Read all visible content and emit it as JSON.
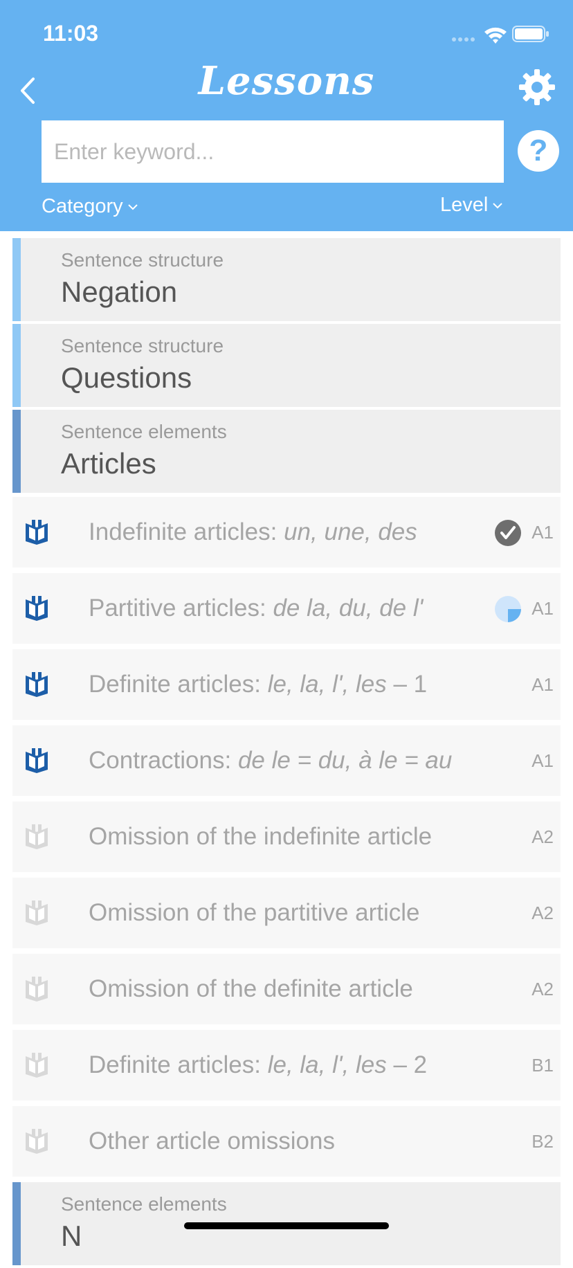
{
  "status_bar": {
    "time": "11:03"
  },
  "header": {
    "title": "Lessons",
    "search_placeholder": "Enter keyword...",
    "help_label": "?",
    "category_filter": "Category",
    "level_filter": "Level"
  },
  "colors": {
    "header_bg": "#65b2f1",
    "accent_light": "#8fc8f5",
    "accent_dark": "#6796cc",
    "book_active": "#1d5ea8",
    "book_inactive": "#d8d8d8"
  },
  "sections": [
    {
      "category": "Sentence structure",
      "name": "Negation"
    },
    {
      "category": "Sentence structure",
      "name": "Questions"
    },
    {
      "category": "Sentence elements",
      "name": "Articles"
    },
    {
      "category": "Sentence elements",
      "name": "N"
    }
  ],
  "lessons": [
    {
      "title": "Indefinite articles: ",
      "example": "un, une, des",
      "level": "A1",
      "status": "completed",
      "unlocked": true
    },
    {
      "title": "Partitive articles: ",
      "example": "de la, du, de l'",
      "level": "A1",
      "status": "in-progress",
      "progress": 0.25,
      "unlocked": true
    },
    {
      "title": "Definite articles: ",
      "example": "le, la, l', les",
      "suffix": " – 1",
      "level": "A1",
      "status": "none",
      "unlocked": true
    },
    {
      "title": "Contractions: ",
      "example": "de le = du, à le = au",
      "level": "A1",
      "status": "none",
      "unlocked": true
    },
    {
      "title": "Omission of the indefinite article",
      "level": "A2",
      "status": "none",
      "unlocked": false
    },
    {
      "title": "Omission of the partitive article",
      "level": "A2",
      "status": "none",
      "unlocked": false
    },
    {
      "title": "Omission of the definite article",
      "level": "A2",
      "status": "none",
      "unlocked": false
    },
    {
      "title": "Definite articles: ",
      "example": "le, la, l', les",
      "suffix": " – 2",
      "level": "B1",
      "status": "none",
      "unlocked": false
    },
    {
      "title": "Other article omissions",
      "level": "B2",
      "status": "none",
      "unlocked": false
    }
  ]
}
